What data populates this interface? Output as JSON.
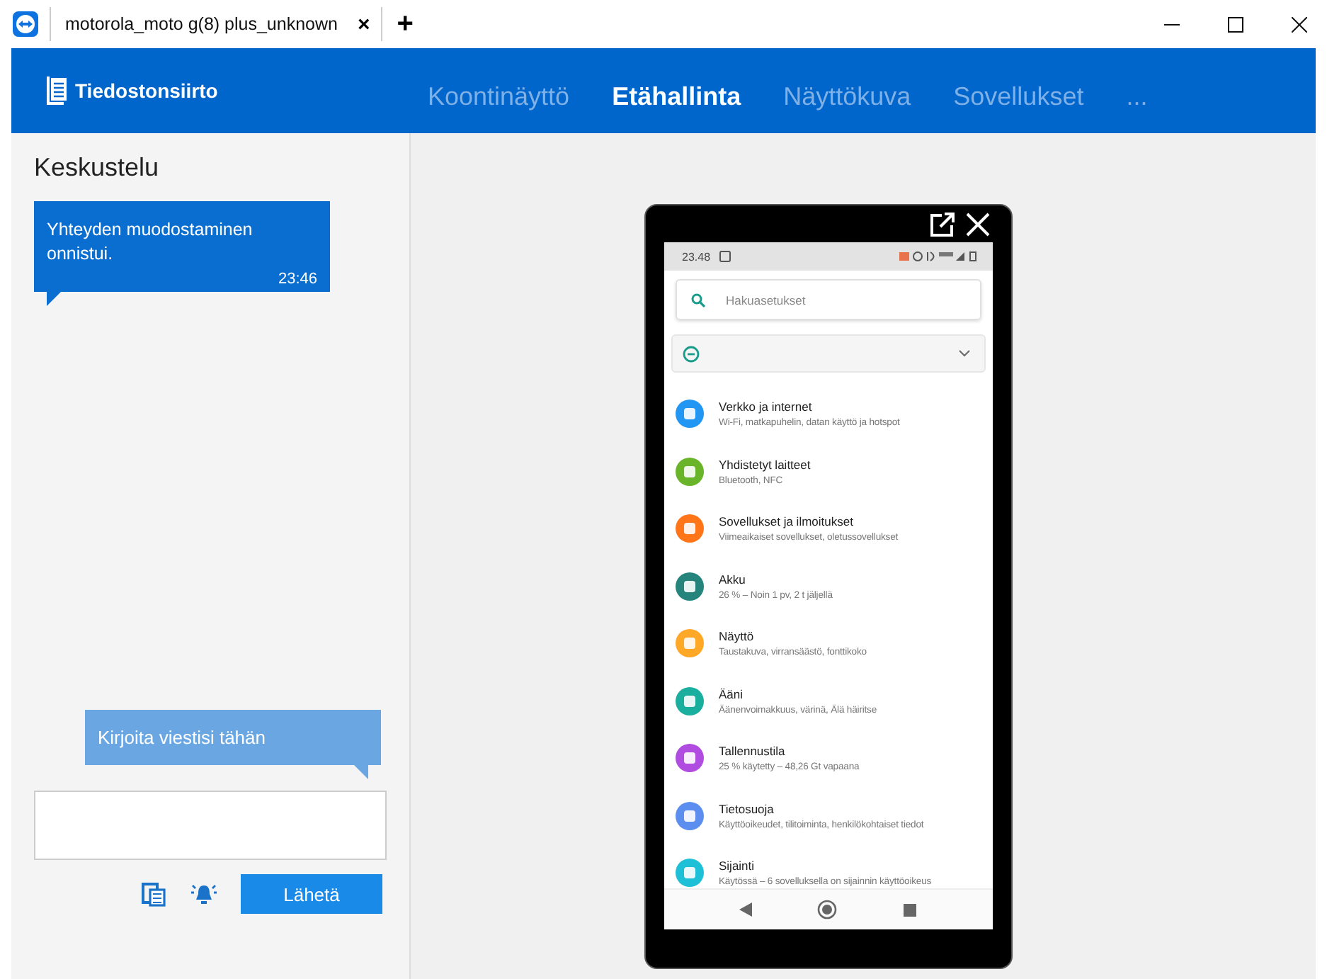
{
  "title_bar": {
    "tab": {
      "label": "motorola_moto g(8) plus_unknown",
      "close": "×"
    },
    "new_tab": "+"
  },
  "header": {
    "app_name": "Tiedostonsiirto",
    "tabs": [
      {
        "label": "Koontinäyttö",
        "selected": false
      },
      {
        "label": "Etähallinta",
        "selected": true
      },
      {
        "label": "Näyttökuva",
        "selected": false
      },
      {
        "label": "Sovellukset",
        "selected": false
      },
      {
        "label": "...",
        "selected": false
      }
    ]
  },
  "chat": {
    "title": "Keskustelu",
    "messages": [
      {
        "text": "Yhteyden muodostaminen onnistui.",
        "time": "23:46"
      }
    ],
    "hint": "Kirjoita viestisi tähän",
    "send_button": "Lähetä"
  },
  "phone": {
    "status_time": "23.48",
    "search_placeholder": "Hakuasetukset",
    "settings": [
      {
        "title": "Verkko ja internet",
        "subtitle": "Wi-Fi, matkapuhelin, datan käyttö ja hotspot",
        "color": "#2196f3"
      },
      {
        "title": "Yhdistetyt laitteet",
        "subtitle": "Bluetooth, NFC",
        "color": "#6ab42a"
      },
      {
        "title": "Sovellukset ja ilmoitukset",
        "subtitle": "Viimeaikaiset sovellukset, oletussovellukset",
        "color": "#ff7518"
      },
      {
        "title": "Akku",
        "subtitle": "26 % – Noin 1 pv, 2 t jäljellä",
        "color": "#25857c"
      },
      {
        "title": "Näyttö",
        "subtitle": "Taustakuva, virransäästö, fonttikoko",
        "color": "#ffa726"
      },
      {
        "title": "Ääni",
        "subtitle": "Äänenvoimakkuus, värinä, Älä häiritse",
        "color": "#1aae9f"
      },
      {
        "title": "Tallennustila",
        "subtitle": "25 % käytetty – 48,26 Gt vapaana",
        "color": "#b04de0"
      },
      {
        "title": "Tietosuoja",
        "subtitle": "Käyttöoikeudet, tilitoiminta, henkilökohtaiset tiedot",
        "color": "#5c8ef0"
      },
      {
        "title": "Sijainti",
        "subtitle": "Käytössä – 6 sovelluksella on sijainnin käyttöoikeus",
        "color": "#1ec0d8"
      }
    ]
  }
}
